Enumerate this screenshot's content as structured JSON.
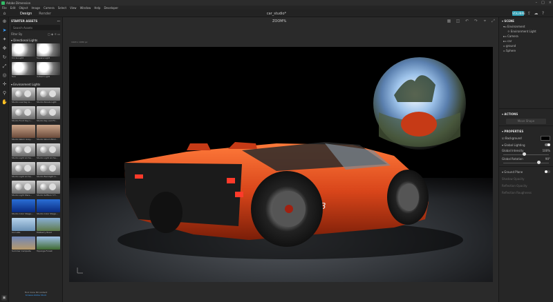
{
  "titlebar": {
    "title": "Adobe Dimension"
  },
  "menu": [
    "File",
    "Edit",
    "Object",
    "Image",
    "Camera",
    "Select",
    "View",
    "Window",
    "Help",
    "Developer"
  ],
  "topbar": {
    "tabs": [
      {
        "label": "Design"
      },
      {
        "label": "Render"
      }
    ],
    "doc_title": "car_studio*",
    "share_label": "VOLUBRE"
  },
  "assets": {
    "header": "STARTER ASSETS",
    "search_placeholder": "Search Assets",
    "filter_label": "Filter By",
    "directional": {
      "title": "Directional Lights",
      "items": [
        "Circle Light",
        "Square Light",
        "Sun",
        "3-Point Light"
      ]
    },
    "environment": {
      "title": "Environment Lights",
      "items": [
        "Studio Low Key Li...",
        "Studio Panels Light",
        "Studio Front Key L...",
        "Studio Key and Fil...",
        "Studio Warm Grey...",
        "Studio Wood Wind...",
        "Studio Light Arche...",
        "Studio Light Arche...",
        "Studio Light Arche...",
        "Studio Backlight A...",
        "Studio Light Wars...",
        "Studio Softbox 3 F...",
        "Studio Color Stage...",
        "Studio Color Stage...",
        "Ice Lake",
        "Mulberry Road",
        "Summer Campsite",
        "Topanga Forest"
      ]
    },
    "footer_text": "Find more 3D content",
    "footer_link": "browse Adobe Stock"
  },
  "viewport": {
    "size_hint": "1920 x 1080 px",
    "zoom": "ZOOM%"
  },
  "scene": {
    "header": "SCENE",
    "items": [
      {
        "label": "Environment",
        "child": false
      },
      {
        "label": "Environment Light",
        "child": true
      },
      {
        "label": "Camera",
        "child": false
      },
      {
        "label": "car",
        "child": false
      },
      {
        "label": "ground",
        "child": false
      },
      {
        "label": "Sphere",
        "child": false
      }
    ]
  },
  "actions": {
    "header": "ACTIONS",
    "button": "Move Shape"
  },
  "properties": {
    "header": "PROPERTIES",
    "background_label": "Background",
    "global_lighting": "Global Lighting",
    "global_intensity_label": "Global Intensity",
    "global_intensity_value": "100%",
    "global_rotation_label": "Global Rotation",
    "global_rotation_value": "90°",
    "ground_plane": "Ground Plane",
    "ground_rows": [
      "Shadow Opacity",
      "Reflection Opacity",
      "Reflection Roughness"
    ]
  },
  "chart_data": null,
  "colors": {
    "accent": "#2a9bb0",
    "car": "#d8451a",
    "canvas_bg": "#000000"
  }
}
